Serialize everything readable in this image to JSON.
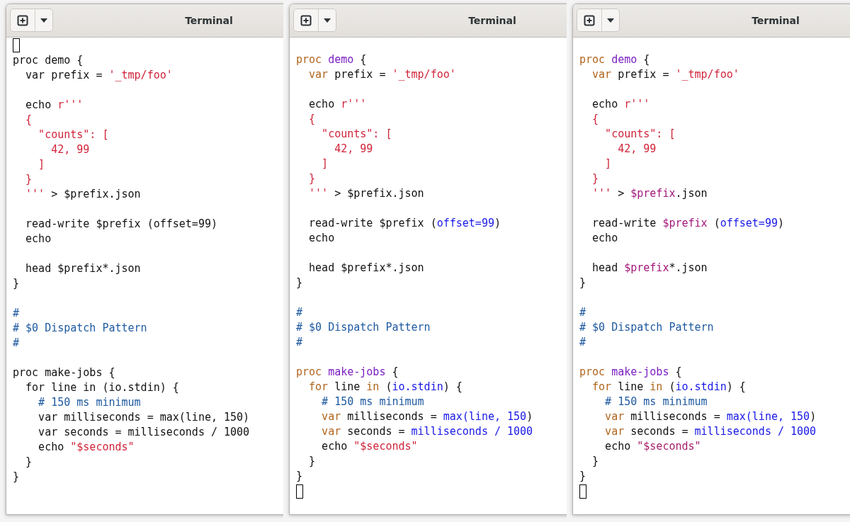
{
  "windows": [
    {
      "title": "Terminal",
      "lines": [
        {
          "kind": "cursor"
        },
        {
          "kind": "code",
          "tokens": [
            {
              "text": "proc demo {",
              "kind": "plain"
            }
          ]
        },
        {
          "kind": "code",
          "tokens": [
            {
              "text": "  var prefix = ",
              "kind": "plain"
            },
            {
              "text": "'_tmp/foo'",
              "kind": "string"
            }
          ]
        },
        {
          "kind": "blank"
        },
        {
          "kind": "code",
          "tokens": [
            {
              "text": "  echo ",
              "kind": "plain"
            },
            {
              "text": "r'''",
              "kind": "string"
            }
          ]
        },
        {
          "kind": "code",
          "tokens": [
            {
              "text": "  {",
              "kind": "string"
            }
          ]
        },
        {
          "kind": "code",
          "tokens": [
            {
              "text": "    \"counts\": [",
              "kind": "string"
            }
          ]
        },
        {
          "kind": "code",
          "tokens": [
            {
              "text": "      42, 99",
              "kind": "string"
            }
          ]
        },
        {
          "kind": "code",
          "tokens": [
            {
              "text": "    ]",
              "kind": "string"
            }
          ]
        },
        {
          "kind": "code",
          "tokens": [
            {
              "text": "  }",
              "kind": "string"
            }
          ]
        },
        {
          "kind": "code",
          "tokens": [
            {
              "text": "  '''",
              "kind": "string"
            },
            {
              "text": " > $prefix.json",
              "kind": "plain"
            }
          ]
        },
        {
          "kind": "blank"
        },
        {
          "kind": "code",
          "tokens": [
            {
              "text": "  read-write $prefix (offset=99)",
              "kind": "plain"
            }
          ]
        },
        {
          "kind": "code",
          "tokens": [
            {
              "text": "  echo",
              "kind": "plain"
            }
          ]
        },
        {
          "kind": "blank"
        },
        {
          "kind": "code",
          "tokens": [
            {
              "text": "  head $prefix*.json",
              "kind": "plain"
            }
          ]
        },
        {
          "kind": "code",
          "tokens": [
            {
              "text": "}",
              "kind": "plain"
            }
          ]
        },
        {
          "kind": "blank"
        },
        {
          "kind": "code",
          "tokens": [
            {
              "text": "#",
              "kind": "comment"
            }
          ]
        },
        {
          "kind": "code",
          "tokens": [
            {
              "text": "# $0 Dispatch Pattern",
              "kind": "comment"
            }
          ]
        },
        {
          "kind": "code",
          "tokens": [
            {
              "text": "#",
              "kind": "comment"
            }
          ]
        },
        {
          "kind": "blank"
        },
        {
          "kind": "code",
          "tokens": [
            {
              "text": "proc make-jobs {",
              "kind": "plain"
            }
          ]
        },
        {
          "kind": "code",
          "tokens": [
            {
              "text": "  for line in (io.stdin) {",
              "kind": "plain"
            }
          ]
        },
        {
          "kind": "code",
          "tokens": [
            {
              "text": "    # 150 ms minimum",
              "kind": "comment"
            }
          ]
        },
        {
          "kind": "code",
          "tokens": [
            {
              "text": "    var milliseconds = max(line, 150)",
              "kind": "plain"
            }
          ]
        },
        {
          "kind": "code",
          "tokens": [
            {
              "text": "    var seconds = milliseconds / 1000",
              "kind": "plain"
            }
          ]
        },
        {
          "kind": "code",
          "tokens": [
            {
              "text": "    echo ",
              "kind": "plain"
            },
            {
              "text": "\"$seconds\"",
              "kind": "string"
            }
          ]
        },
        {
          "kind": "code",
          "tokens": [
            {
              "text": "  }",
              "kind": "plain"
            }
          ]
        },
        {
          "kind": "code",
          "tokens": [
            {
              "text": "}",
              "kind": "plain"
            }
          ]
        }
      ]
    },
    {
      "title": "Terminal",
      "lines": [
        {
          "kind": "blank"
        },
        {
          "kind": "code",
          "tokens": [
            {
              "text": "proc ",
              "kind": "keyword"
            },
            {
              "text": "demo",
              "kind": "name"
            },
            {
              "text": " {",
              "kind": "plain"
            }
          ]
        },
        {
          "kind": "code",
          "tokens": [
            {
              "text": "  var",
              "kind": "keyword"
            },
            {
              "text": " prefix = ",
              "kind": "plain"
            },
            {
              "text": "'_tmp/foo'",
              "kind": "string"
            }
          ]
        },
        {
          "kind": "blank"
        },
        {
          "kind": "code",
          "tokens": [
            {
              "text": "  echo ",
              "kind": "plain"
            },
            {
              "text": "r'''",
              "kind": "string"
            }
          ]
        },
        {
          "kind": "code",
          "tokens": [
            {
              "text": "  {",
              "kind": "string"
            }
          ]
        },
        {
          "kind": "code",
          "tokens": [
            {
              "text": "    \"counts\": [",
              "kind": "string"
            }
          ]
        },
        {
          "kind": "code",
          "tokens": [
            {
              "text": "      42, 99",
              "kind": "string"
            }
          ]
        },
        {
          "kind": "code",
          "tokens": [
            {
              "text": "    ]",
              "kind": "string"
            }
          ]
        },
        {
          "kind": "code",
          "tokens": [
            {
              "text": "  }",
              "kind": "string"
            }
          ]
        },
        {
          "kind": "code",
          "tokens": [
            {
              "text": "  '''",
              "kind": "string"
            },
            {
              "text": " > $prefix.json",
              "kind": "plain"
            }
          ]
        },
        {
          "kind": "blank"
        },
        {
          "kind": "code",
          "tokens": [
            {
              "text": "  read-write $prefix (",
              "kind": "plain"
            },
            {
              "text": "offset=99",
              "kind": "expr"
            },
            {
              "text": ")",
              "kind": "plain"
            }
          ]
        },
        {
          "kind": "code",
          "tokens": [
            {
              "text": "  echo",
              "kind": "plain"
            }
          ]
        },
        {
          "kind": "blank"
        },
        {
          "kind": "code",
          "tokens": [
            {
              "text": "  head $prefix*.json",
              "kind": "plain"
            }
          ]
        },
        {
          "kind": "code",
          "tokens": [
            {
              "text": "}",
              "kind": "plain"
            }
          ]
        },
        {
          "kind": "blank"
        },
        {
          "kind": "code",
          "tokens": [
            {
              "text": "#",
              "kind": "comment"
            }
          ]
        },
        {
          "kind": "code",
          "tokens": [
            {
              "text": "# $0 Dispatch Pattern",
              "kind": "comment"
            }
          ]
        },
        {
          "kind": "code",
          "tokens": [
            {
              "text": "#",
              "kind": "comment"
            }
          ]
        },
        {
          "kind": "blank"
        },
        {
          "kind": "code",
          "tokens": [
            {
              "text": "proc ",
              "kind": "keyword"
            },
            {
              "text": "make-jobs",
              "kind": "name"
            },
            {
              "text": " {",
              "kind": "plain"
            }
          ]
        },
        {
          "kind": "code",
          "tokens": [
            {
              "text": "  for",
              "kind": "keyword"
            },
            {
              "text": " line ",
              "kind": "plain"
            },
            {
              "text": "in",
              "kind": "keyword"
            },
            {
              "text": " (",
              "kind": "plain"
            },
            {
              "text": "io.stdin",
              "kind": "expr"
            },
            {
              "text": ") {",
              "kind": "plain"
            }
          ]
        },
        {
          "kind": "code",
          "tokens": [
            {
              "text": "    # 150 ms minimum",
              "kind": "comment"
            }
          ]
        },
        {
          "kind": "code",
          "tokens": [
            {
              "text": "    var",
              "kind": "keyword"
            },
            {
              "text": " milliseconds = ",
              "kind": "plain"
            },
            {
              "text": "max(line, 150",
              "kind": "expr"
            },
            {
              "text": ")",
              "kind": "plain"
            }
          ]
        },
        {
          "kind": "code",
          "tokens": [
            {
              "text": "    var",
              "kind": "keyword"
            },
            {
              "text": " seconds = ",
              "kind": "plain"
            },
            {
              "text": "milliseconds / 1000",
              "kind": "expr"
            }
          ]
        },
        {
          "kind": "code",
          "tokens": [
            {
              "text": "    echo ",
              "kind": "plain"
            },
            {
              "text": "\"$seconds\"",
              "kind": "string"
            }
          ]
        },
        {
          "kind": "code",
          "tokens": [
            {
              "text": "  }",
              "kind": "plain"
            }
          ]
        },
        {
          "kind": "code",
          "tokens": [
            {
              "text": "}",
              "kind": "plain"
            }
          ]
        },
        {
          "kind": "cursor"
        }
      ]
    },
    {
      "title": "Terminal",
      "lines": [
        {
          "kind": "blank"
        },
        {
          "kind": "code",
          "tokens": [
            {
              "text": "proc ",
              "kind": "keyword"
            },
            {
              "text": "demo",
              "kind": "name"
            },
            {
              "text": " {",
              "kind": "plain"
            }
          ]
        },
        {
          "kind": "code",
          "tokens": [
            {
              "text": "  var",
              "kind": "keyword"
            },
            {
              "text": " prefix = ",
              "kind": "plain"
            },
            {
              "text": "'_tmp/foo'",
              "kind": "string"
            }
          ]
        },
        {
          "kind": "blank"
        },
        {
          "kind": "code",
          "tokens": [
            {
              "text": "  echo ",
              "kind": "plain"
            },
            {
              "text": "r'''",
              "kind": "string"
            }
          ]
        },
        {
          "kind": "code",
          "tokens": [
            {
              "text": "  {",
              "kind": "string"
            }
          ]
        },
        {
          "kind": "code",
          "tokens": [
            {
              "text": "    \"counts\": [",
              "kind": "string"
            }
          ]
        },
        {
          "kind": "code",
          "tokens": [
            {
              "text": "      42, 99",
              "kind": "string"
            }
          ]
        },
        {
          "kind": "code",
          "tokens": [
            {
              "text": "    ]",
              "kind": "string"
            }
          ]
        },
        {
          "kind": "code",
          "tokens": [
            {
              "text": "  }",
              "kind": "string"
            }
          ]
        },
        {
          "kind": "code",
          "tokens": [
            {
              "text": "  '''",
              "kind": "string"
            },
            {
              "text": " > ",
              "kind": "plain"
            },
            {
              "text": "$prefix",
              "kind": "variable"
            },
            {
              "text": ".json",
              "kind": "plain"
            }
          ]
        },
        {
          "kind": "blank"
        },
        {
          "kind": "code",
          "tokens": [
            {
              "text": "  read-write ",
              "kind": "plain"
            },
            {
              "text": "$prefix",
              "kind": "variable"
            },
            {
              "text": " (",
              "kind": "plain"
            },
            {
              "text": "offset=99",
              "kind": "expr"
            },
            {
              "text": ")",
              "kind": "plain"
            }
          ]
        },
        {
          "kind": "code",
          "tokens": [
            {
              "text": "  echo",
              "kind": "plain"
            }
          ]
        },
        {
          "kind": "blank"
        },
        {
          "kind": "code",
          "tokens": [
            {
              "text": "  head ",
              "kind": "plain"
            },
            {
              "text": "$prefix",
              "kind": "variable"
            },
            {
              "text": "*.json",
              "kind": "plain"
            }
          ]
        },
        {
          "kind": "code",
          "tokens": [
            {
              "text": "}",
              "kind": "plain"
            }
          ]
        },
        {
          "kind": "blank"
        },
        {
          "kind": "code",
          "tokens": [
            {
              "text": "#",
              "kind": "comment"
            }
          ]
        },
        {
          "kind": "code",
          "tokens": [
            {
              "text": "# $0 Dispatch Pattern",
              "kind": "comment"
            }
          ]
        },
        {
          "kind": "code",
          "tokens": [
            {
              "text": "#",
              "kind": "comment"
            }
          ]
        },
        {
          "kind": "blank"
        },
        {
          "kind": "code",
          "tokens": [
            {
              "text": "proc ",
              "kind": "keyword"
            },
            {
              "text": "make-jobs",
              "kind": "name"
            },
            {
              "text": " {",
              "kind": "plain"
            }
          ]
        },
        {
          "kind": "code",
          "tokens": [
            {
              "text": "  for",
              "kind": "keyword"
            },
            {
              "text": " line ",
              "kind": "plain"
            },
            {
              "text": "in",
              "kind": "keyword"
            },
            {
              "text": " (",
              "kind": "plain"
            },
            {
              "text": "io.stdin",
              "kind": "expr"
            },
            {
              "text": ") {",
              "kind": "plain"
            }
          ]
        },
        {
          "kind": "code",
          "tokens": [
            {
              "text": "    # 150 ms minimum",
              "kind": "comment"
            }
          ]
        },
        {
          "kind": "code",
          "tokens": [
            {
              "text": "    var",
              "kind": "keyword"
            },
            {
              "text": " milliseconds = ",
              "kind": "plain"
            },
            {
              "text": "max(line, 150",
              "kind": "expr"
            },
            {
              "text": ")",
              "kind": "plain"
            }
          ]
        },
        {
          "kind": "code",
          "tokens": [
            {
              "text": "    var",
              "kind": "keyword"
            },
            {
              "text": " seconds = ",
              "kind": "plain"
            },
            {
              "text": "milliseconds / 1000",
              "kind": "expr"
            }
          ]
        },
        {
          "kind": "code",
          "tokens": [
            {
              "text": "    echo ",
              "kind": "plain"
            },
            {
              "text": "\"$seconds\"",
              "kind": "interp"
            }
          ]
        },
        {
          "kind": "code",
          "tokens": [
            {
              "text": "  }",
              "kind": "plain"
            }
          ]
        },
        {
          "kind": "code",
          "tokens": [
            {
              "text": "}",
              "kind": "plain"
            }
          ]
        },
        {
          "kind": "cursor"
        }
      ]
    }
  ]
}
